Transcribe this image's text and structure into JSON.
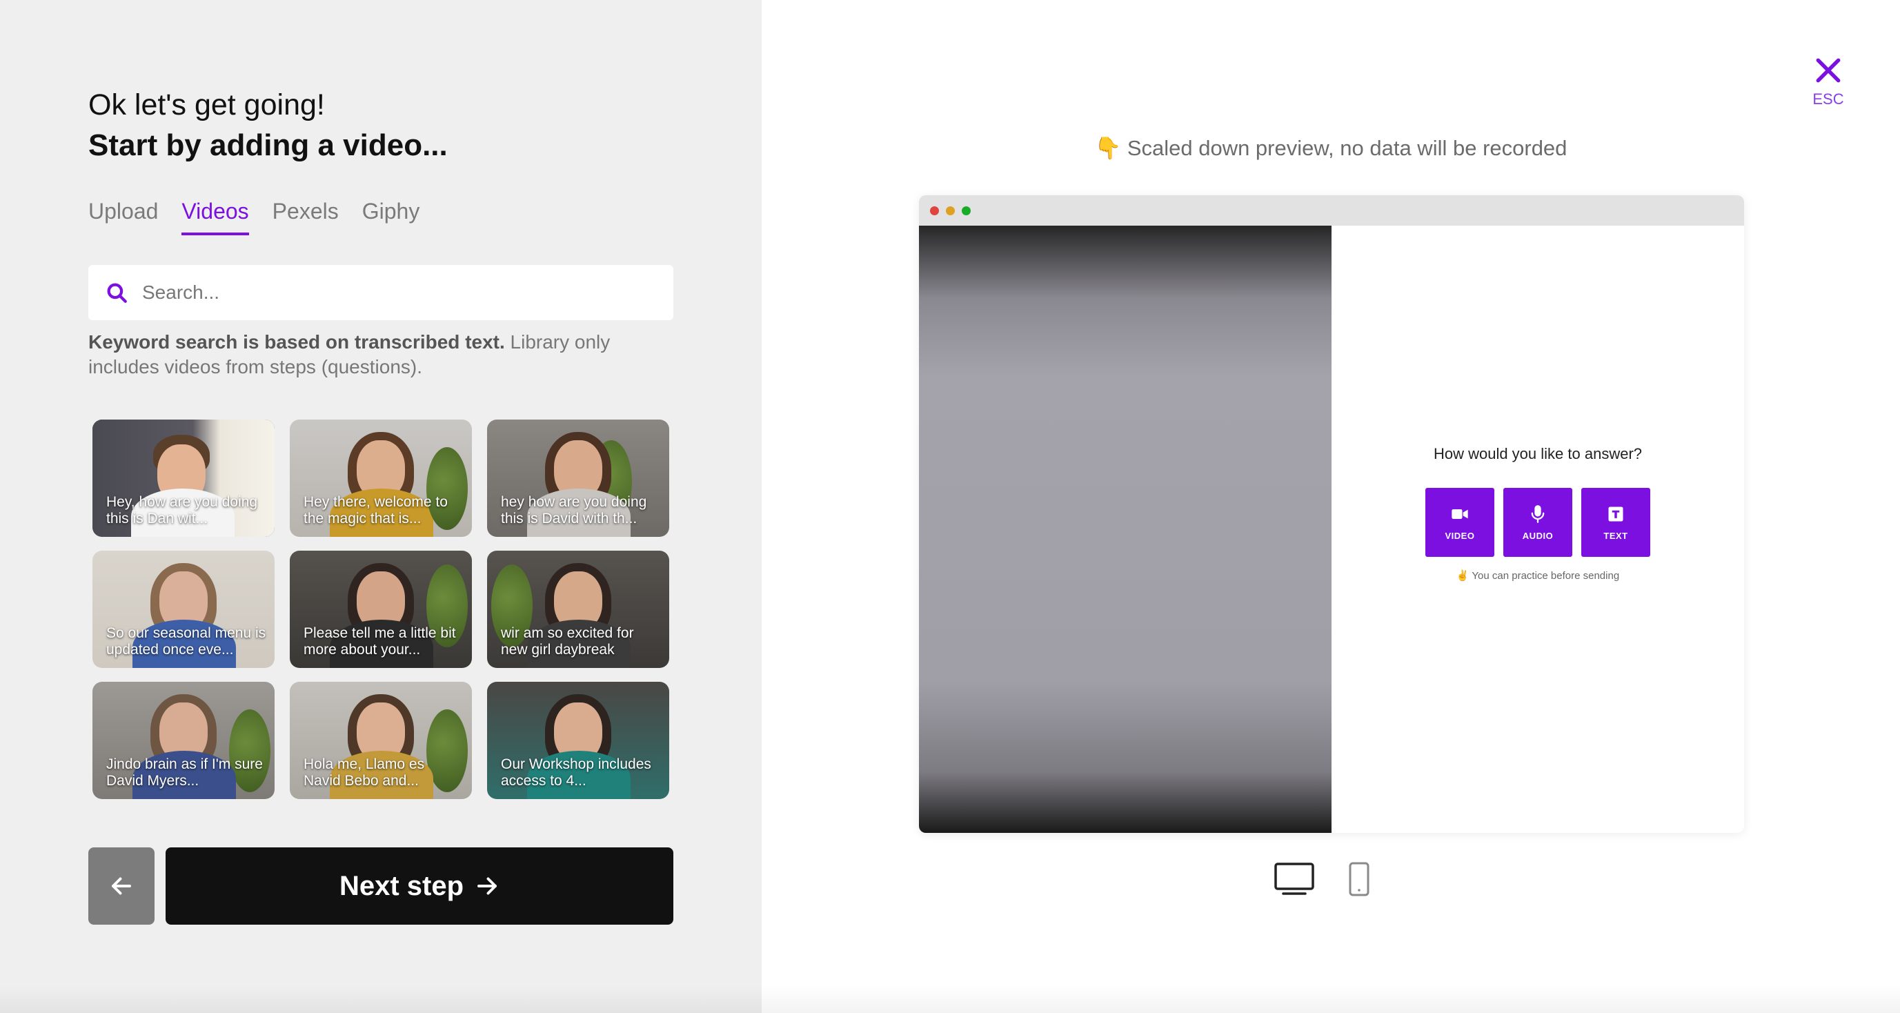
{
  "left": {
    "heading_line1": "Ok let's get going!",
    "heading_line2": "Start by adding a video...",
    "tabs": [
      {
        "label": "Upload",
        "active": false
      },
      {
        "label": "Videos",
        "active": true
      },
      {
        "label": "Pexels",
        "active": false
      },
      {
        "label": "Giphy",
        "active": false
      }
    ],
    "search": {
      "placeholder": "Search...",
      "value": ""
    },
    "help_bold": "Keyword search is based on transcribed text.",
    "help_rest": "Library only includes videos from steps (questions).",
    "videos": [
      {
        "caption": "Hey, how are you doing this is Dan wit..."
      },
      {
        "caption": "Hey there, welcome to the magic that is..."
      },
      {
        "caption": "hey how are you doing this is David with th..."
      },
      {
        "caption": "So our seasonal menu is updated once eve..."
      },
      {
        "caption": "Please tell me a little bit more about your..."
      },
      {
        "caption": "wir am so excited for new girl daybreak"
      },
      {
        "caption": "Jindo brain as if I'm sure David Myers..."
      },
      {
        "caption": "Hola me, Llamo es Navid Bebo and..."
      },
      {
        "caption": "Our Workshop includes access to 4..."
      }
    ],
    "back_icon": "arrow-left-icon",
    "next_label": "Next step"
  },
  "right": {
    "close_label": "ESC",
    "preview_emoji": "👇",
    "preview_note": "Scaled down preview, no data will be recorded",
    "answer_question": "How would you like to answer?",
    "answer_buttons": [
      {
        "label": "VIDEO",
        "icon": "video-camera-icon"
      },
      {
        "label": "AUDIO",
        "icon": "microphone-icon"
      },
      {
        "label": "TEXT",
        "icon": "text-icon"
      }
    ],
    "practice_emoji": "✌️",
    "practice_note": "You can practice before sending",
    "devices": [
      {
        "icon": "desktop-icon",
        "active": true
      },
      {
        "icon": "mobile-icon",
        "active": false
      }
    ]
  },
  "colors": {
    "accent": "#7b10e0",
    "left_bg": "#efefef",
    "next_button": "#111111",
    "back_button": "#7c7c7c",
    "traffic_red": "#e0443e",
    "traffic_yellow": "#dea123",
    "traffic_green": "#1aab29"
  }
}
